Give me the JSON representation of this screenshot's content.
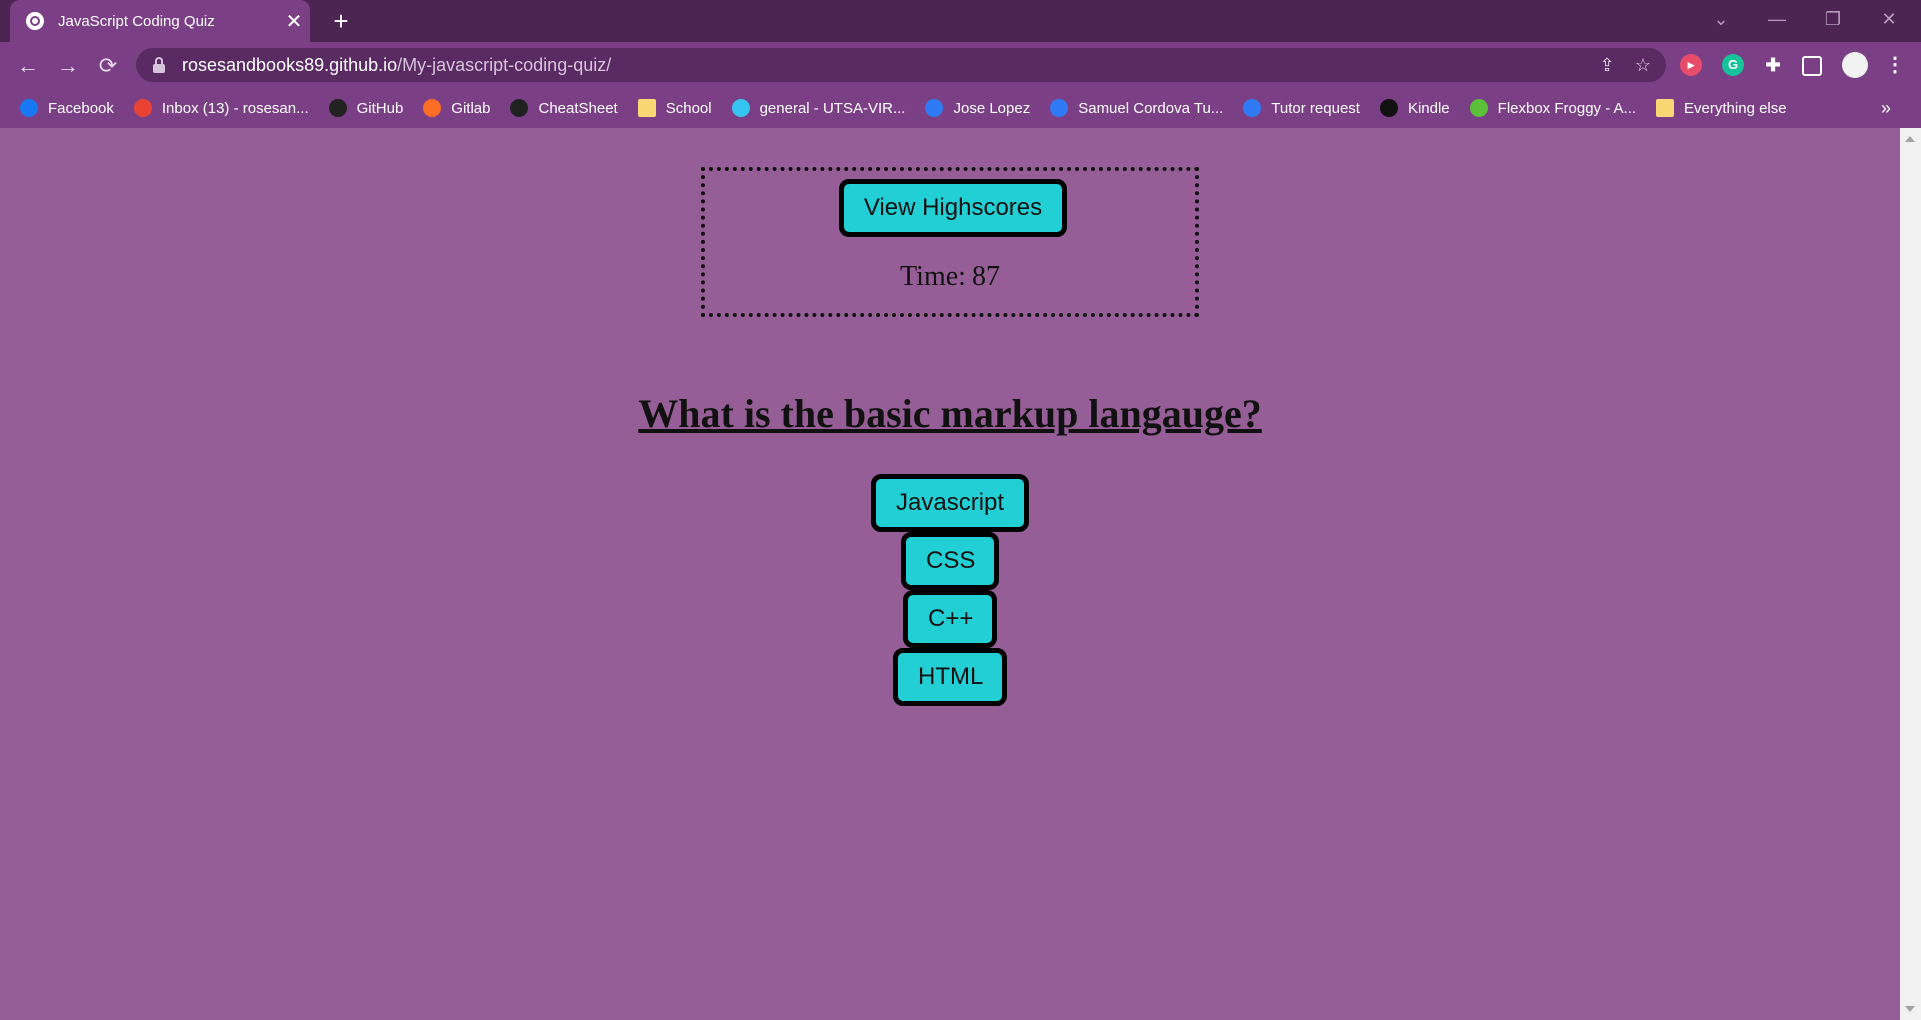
{
  "browser": {
    "tab_title": "JavaScript Coding Quiz",
    "tab_close": "✕",
    "new_tab": "+",
    "url_host": "rosesandbooks89.github.io",
    "url_path": "/My-javascript-coding-quiz/",
    "window_controls": [
      "⌄",
      "—",
      "❐",
      "✕"
    ],
    "bookmarks": [
      {
        "label": "Facebook",
        "icon": "facebook-icon",
        "color": "#1877f2"
      },
      {
        "label": "Inbox (13) - rosesan...",
        "icon": "gmail-icon",
        "color": "#ea4335"
      },
      {
        "label": "GitHub",
        "icon": "github-icon",
        "color": "#222222"
      },
      {
        "label": "Gitlab",
        "icon": "gitlab-icon",
        "color": "#fc6d26"
      },
      {
        "label": "CheatSheet",
        "icon": "github-icon",
        "color": "#222222"
      },
      {
        "label": "School",
        "icon": "folder-icon",
        "color": "#f7d774"
      },
      {
        "label": "general - UTSA-VIR...",
        "icon": "slack-icon",
        "color": "#36c5f0"
      },
      {
        "label": "Jose Lopez",
        "icon": "link-icon",
        "color": "#2f7bf6"
      },
      {
        "label": "Samuel Cordova Tu...",
        "icon": "link-icon",
        "color": "#2f7bf6"
      },
      {
        "label": "Tutor request",
        "icon": "link-icon",
        "color": "#2f7bf6"
      },
      {
        "label": "Kindle",
        "icon": "kindle-icon",
        "color": "#111111"
      },
      {
        "label": "Flexbox Froggy - A...",
        "icon": "frog-icon",
        "color": "#5bbf3a"
      },
      {
        "label": "Everything else",
        "icon": "folder-icon",
        "color": "#f7d774"
      }
    ],
    "bookmarks_more": "»"
  },
  "quiz": {
    "highscores_label": "View Highscores",
    "timer_label": "Time:",
    "timer_value": "87",
    "question": "What is the basic markup langauge?",
    "answers": [
      "Javascript",
      "CSS",
      "C++",
      "HTML"
    ]
  },
  "colors": {
    "page_bg": "#965e96",
    "button_bg": "#22cfd4",
    "chrome_bg": "#7b3f86",
    "titlebar_bg": "#4d2552"
  }
}
